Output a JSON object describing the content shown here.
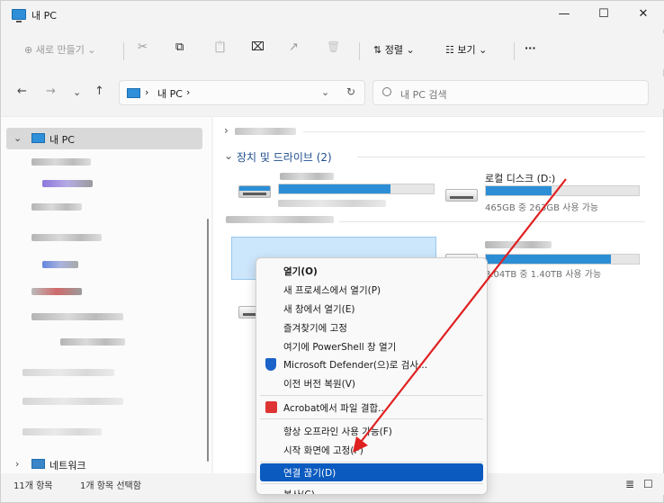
{
  "window": {
    "title": "내 PC",
    "minimize": "—",
    "maximize": "☐",
    "close": "✕"
  },
  "toolbar": {
    "new_label": "⊕ 새로 만들기 ⌄",
    "cut_icon": "✂",
    "copy_icon": "⧉",
    "paste_icon": "📋",
    "rename_icon": "⌧",
    "share_icon": "↗",
    "delete_icon": "🗑",
    "sort_label": "⇅ 정렬 ⌄",
    "view_label": "☷ 보기 ⌄",
    "more_label": "···"
  },
  "nav": {
    "back": "←",
    "forward": "→",
    "recent": "⌄",
    "up": "↑",
    "breadcrumb_sep": "›",
    "breadcrumb": "내 PC",
    "breadcrumb_end": "›",
    "dropdown": "⌄",
    "refresh": "↻"
  },
  "search": {
    "placeholder": "내 PC 검색"
  },
  "sidebar": {
    "expand_icon": "⌄",
    "this_pc": "내 PC",
    "network_chevron": "›",
    "network": "네트워크"
  },
  "content": {
    "folders_chevron": "›",
    "drives_group": "장치 및 드라이브 (2)",
    "drives_chevron": "⌄",
    "drive_d": {
      "name": "로컬 디스크 (D:)",
      "info": "465GB 중 263GB 사용 가능",
      "used_fraction": 0.43
    },
    "drive_c_used_fraction": 0.72,
    "drive_net": {
      "info": "3.04TB 중 1.40TB 사용 가능",
      "used_fraction": 0.82
    }
  },
  "context_menu": {
    "items": [
      "열기(O)",
      "새 프로세스에서 열기(P)",
      "새 창에서 열기(E)",
      "즐겨찾기에 고정",
      "여기에 PowerShell 창 열기",
      "Microsoft Defender(으)로 검사...",
      "이전 버전 복원(V)",
      "Acrobat에서 파일 결합...",
      "항상 오프라인 사용 가능(F)",
      "시작 화면에 고정(P)",
      "연결 끊기(D)",
      "복사(C)"
    ]
  },
  "status": {
    "count": "11개 항목",
    "selected": "1개 항목 선택함",
    "details_icon": "≣",
    "tiles_icon": "☐"
  },
  "colors": {
    "accent": "#0a5ac0",
    "bar": "#2c8fd6",
    "annotation_arrow": "#e02020"
  }
}
